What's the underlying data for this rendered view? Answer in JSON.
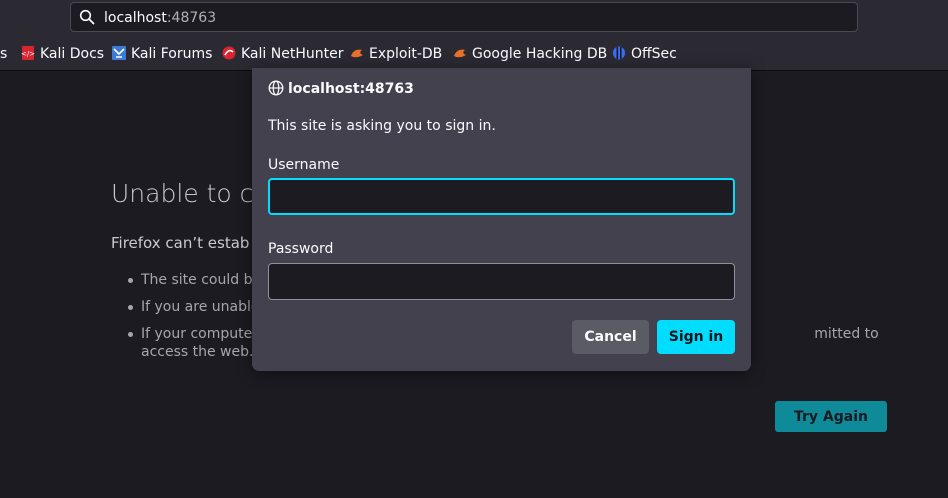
{
  "urlbar": {
    "host": "localhost",
    "port": ":48763",
    "icon": "search-icon"
  },
  "bookmarks": [
    {
      "label": "s",
      "icon": "none"
    },
    {
      "label": "Kali Docs",
      "icon": "kali-docs-icon"
    },
    {
      "label": "Kali Forums",
      "icon": "kali-forums-icon"
    },
    {
      "label": "Kali NetHunter",
      "icon": "kali-nethunter-icon"
    },
    {
      "label": "Exploit-DB",
      "icon": "exploit-db-icon"
    },
    {
      "label": "Google Hacking DB",
      "icon": "exploit-db-icon"
    },
    {
      "label": "OffSec",
      "icon": "offsec-icon"
    }
  ],
  "error_page": {
    "title": "Unable to co",
    "description": "Firefox can’t estab",
    "items": [
      "The site could be",
      "If you are unable",
      "If your computer                                                                                                                             mitted to access the web."
    ],
    "try_again_label": "Try Again"
  },
  "dialog": {
    "origin": "localhost:48763",
    "message": "This site is asking you to sign in.",
    "username_label": "Username",
    "username_value": "",
    "password_label": "Password",
    "password_value": "",
    "cancel_label": "Cancel",
    "signin_label": "Sign in"
  },
  "colors": {
    "accent": "#00ddff",
    "try_again": "#0e8a98",
    "dialog_bg": "#42414d",
    "page_bg": "#1c1b22"
  }
}
